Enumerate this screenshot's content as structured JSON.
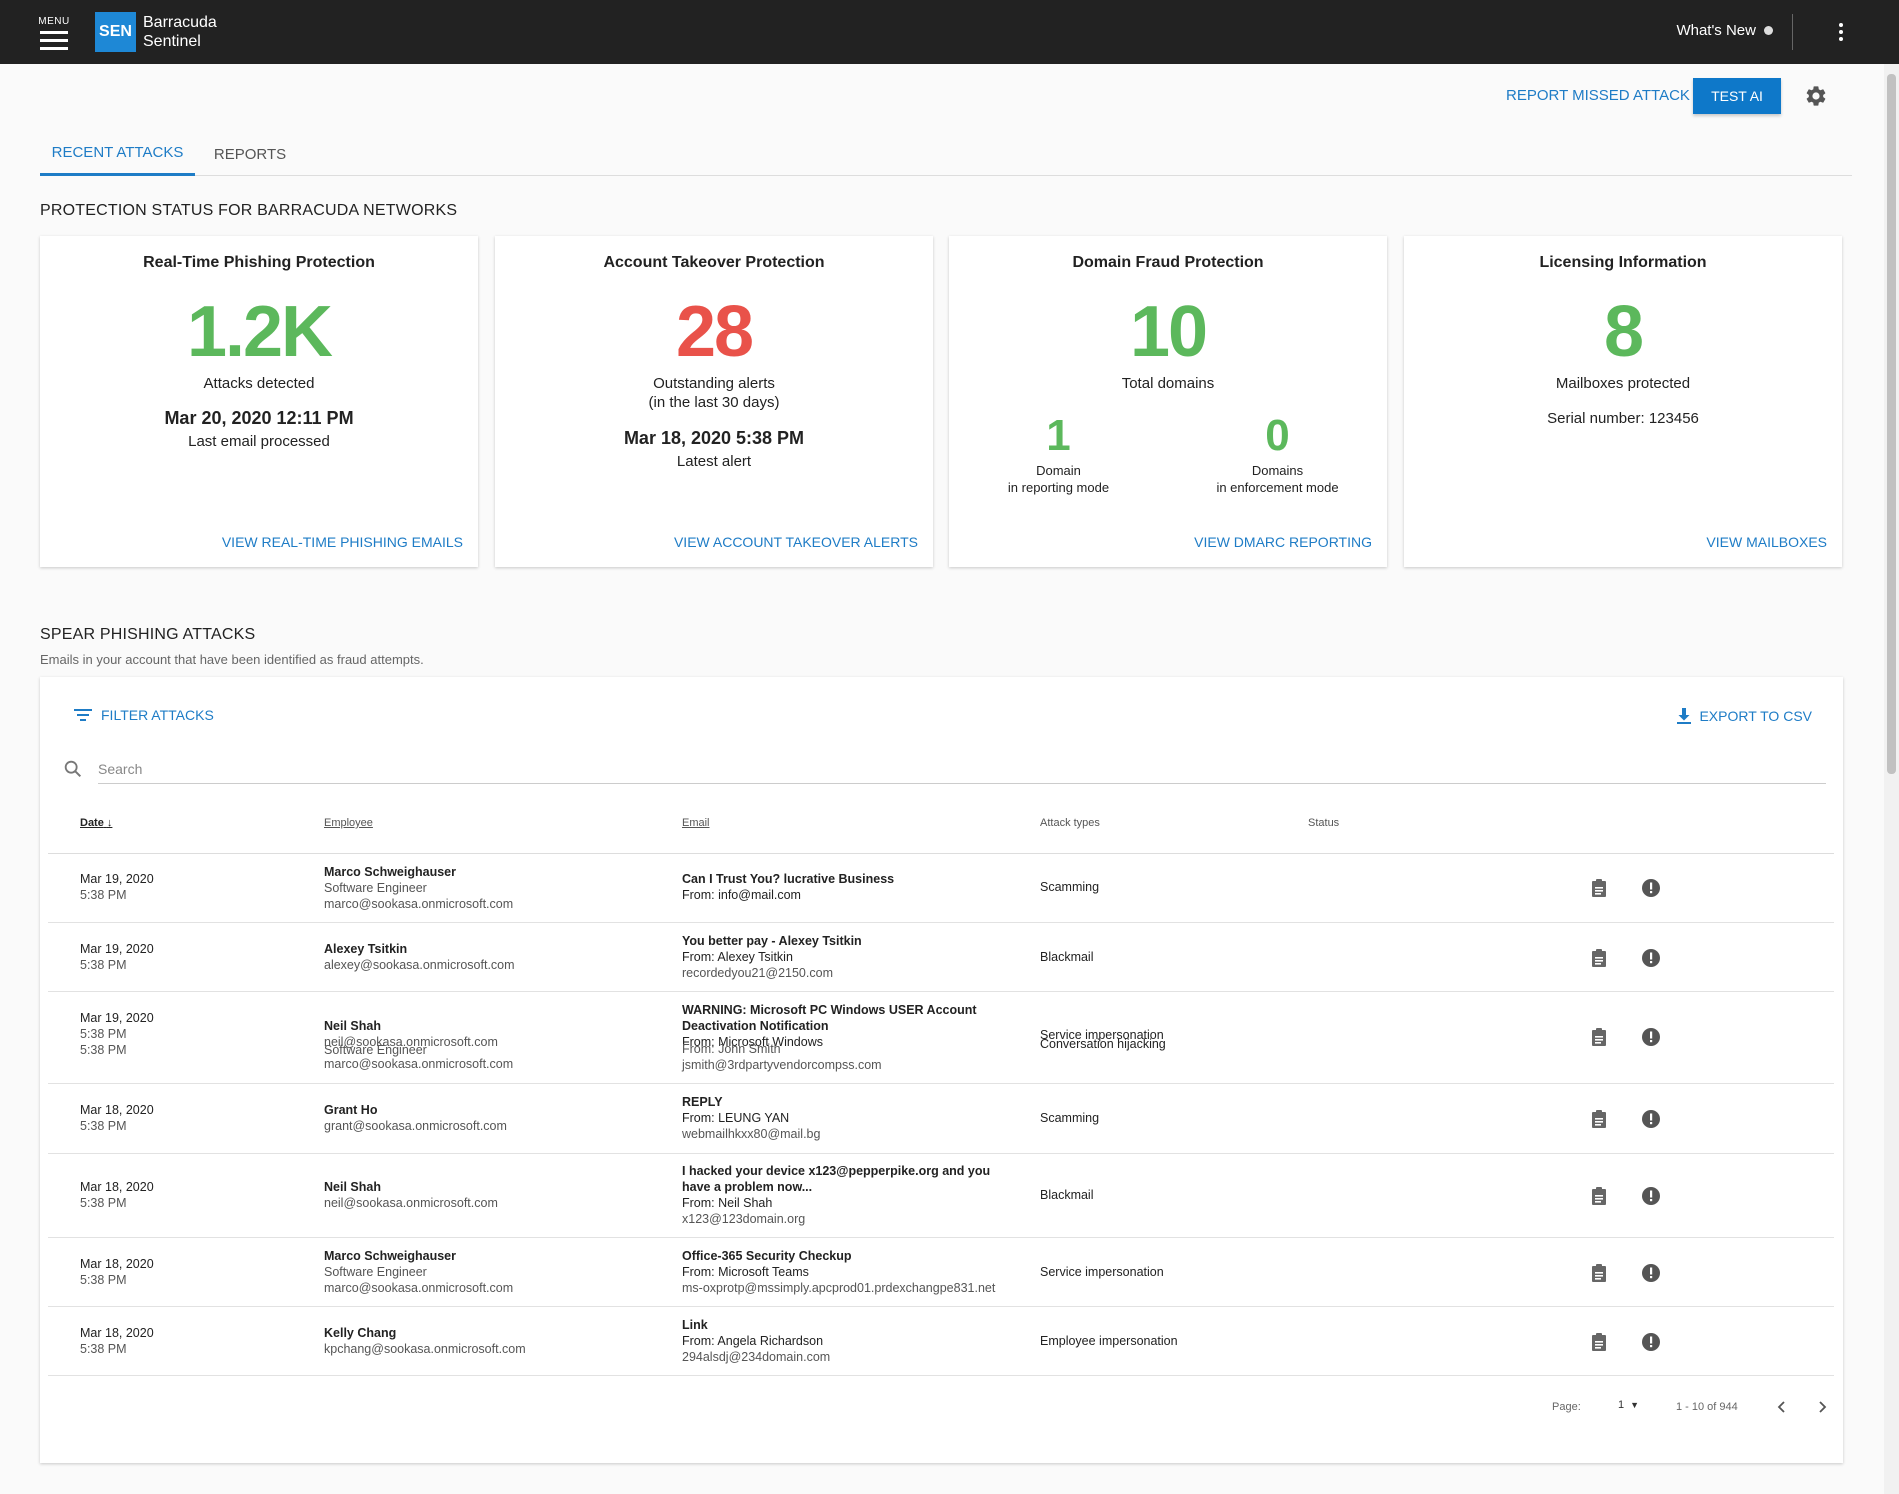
{
  "header": {
    "menu_label": "MENU",
    "logo_abbr": "SEN",
    "brand_line1": "Barracuda",
    "brand_line2": "Sentinel",
    "whats_new": "What's New"
  },
  "actions": {
    "report_missed": "REPORT MISSED ATTACK",
    "test_ai": "TEST AI"
  },
  "tabs": [
    {
      "label": "RECENT ATTACKS",
      "active": true
    },
    {
      "label": "REPORTS",
      "active": false
    }
  ],
  "protection": {
    "title": "PROTECTION STATUS FOR BARRACUDA NETWORKS",
    "cards": {
      "phishing": {
        "title": "Real-Time Phishing Protection",
        "value": "1.2K",
        "value_label": "Attacks detected",
        "datetime": "Mar 20, 2020  12:11 PM",
        "datetime_label": "Last email processed",
        "link": "VIEW REAL-TIME PHISHING EMAILS"
      },
      "takeover": {
        "title": "Account Takeover Protection",
        "value": "28",
        "value_label": "Outstanding alerts",
        "value_sublabel": "(in the last 30 days)",
        "datetime": "Mar 18, 2020  5:38 PM",
        "datetime_label": "Latest alert",
        "link": "VIEW ACCOUNT TAKEOVER ALERTS"
      },
      "domain": {
        "title": "Domain Fraud Protection",
        "value": "10",
        "value_label": "Total domains",
        "reporting_value": "1",
        "reporting_label1": "Domain",
        "reporting_label2": "in reporting mode",
        "enforcement_value": "0",
        "enforcement_label1": "Domains",
        "enforcement_label2": "in enforcement mode",
        "link": "VIEW DMARC REPORTING"
      },
      "licensing": {
        "title": "Licensing Information",
        "value": "8",
        "value_label": "Mailboxes protected",
        "serial": "Serial number: 123456",
        "link": "VIEW MAILBOXES"
      }
    }
  },
  "spear": {
    "title": "SPEAR PHISHING ATTACKS",
    "subtitle": "Emails in your account that have been identified as fraud attempts.",
    "filter": "FILTER ATTACKS",
    "export": "EXPORT TO CSV",
    "search_placeholder": "Search",
    "columns": {
      "date": "Date",
      "employee": "Employee",
      "email": "Email",
      "attack_types": "Attack types",
      "status": "Status"
    },
    "rows": [
      {
        "date": "Mar 19, 2020",
        "time": "5:38 PM",
        "emp_name": "Marco Schweighauser",
        "emp_title": "Software Engineer",
        "emp_email": "marco@sookasa.onmicrosoft.com",
        "subject": "Can I Trust You? lucrative Business",
        "from": "From: info@mail.com",
        "from_email": "",
        "attack": "Scamming"
      },
      {
        "date": "Mar 19, 2020",
        "time": "5:38 PM",
        "emp_name": "Alexey Tsitkin",
        "emp_title": "",
        "emp_email": "alexey@sookasa.onmicrosoft.com",
        "subject": "You better pay - Alexey Tsitkin",
        "from": "From: Alexey Tsitkin",
        "from_email": "recordedyou21@2150.com",
        "attack": "Blackmail"
      },
      {
        "date": "Mar 19, 2020",
        "time": "5:38 PM",
        "time2": "5:38 PM",
        "emp_name": "Neil Shah",
        "emp_email": "neil@sookasa.onmicrosoft.com",
        "emp_overlap": "Software Engineer",
        "emp_email2": "marco@sookasa.onmicrosoft.com",
        "subject": "WARNING: Microsoft PC Windows USER Account Deactivation Notification",
        "from": "From: Microsoft Windows",
        "from_overlap": "From: John Smith",
        "from_email": "jsmith@3rdpartyvendorcompss.com",
        "attack": "Service impersonation",
        "attack_overlap": "Conversation hijacking"
      },
      {
        "date": "Mar 18, 2020",
        "time": "5:38 PM",
        "emp_name": "Grant Ho",
        "emp_title": "",
        "emp_email": "grant@sookasa.onmicrosoft.com",
        "subject": "REPLY",
        "from": "From: LEUNG YAN",
        "from_email": "webmailhkxx80@mail.bg",
        "attack": "Scamming"
      },
      {
        "date": "Mar 18, 2020",
        "time": "5:38 PM",
        "emp_name": "Neil Shah",
        "emp_title": "",
        "emp_email": "neil@sookasa.onmicrosoft.com",
        "subject": "I hacked your device x123@pepperpike.org and you have a problem now...",
        "from": "From: Neil Shah",
        "from_email": "x123@123domain.org",
        "attack": "Blackmail"
      },
      {
        "date": "Mar 18, 2020",
        "time": "5:38 PM",
        "emp_name": "Marco Schweighauser",
        "emp_title": "Software Engineer",
        "emp_email": "marco@sookasa.onmicrosoft.com",
        "subject": "Office-365 Security Checkup",
        "from": "From: Microsoft Teams",
        "from_email": "ms-oxprotp@mssimply.apcprod01.prdexchangpe831.net",
        "attack": "Service impersonation"
      },
      {
        "date": "Mar 18, 2020",
        "time": "5:38 PM",
        "emp_name": "Kelly Chang",
        "emp_title": "",
        "emp_email": "kpchang@sookasa.onmicrosoft.com",
        "subject": "Link",
        "from": "From: Angela Richardson",
        "from_email": "294alsdj@234domain.com",
        "attack": "Employee impersonation"
      }
    ],
    "pagination": {
      "page_label": "Page:",
      "page_value": "1",
      "range": "1 - 10 of 944"
    }
  },
  "colors": {
    "accent": "#1e7cc6",
    "green": "#5cb85c",
    "red": "#e9524a",
    "topbar": "#222222"
  }
}
